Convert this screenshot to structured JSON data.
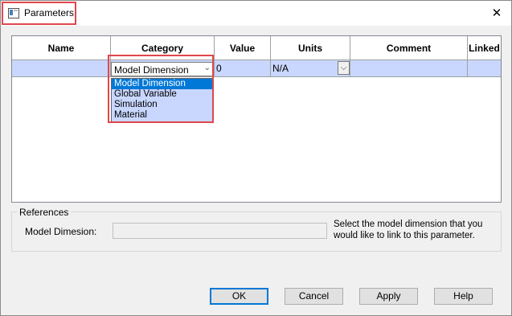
{
  "window": {
    "title": "Parameters",
    "close_glyph": "✕",
    "icon": "window-icon",
    "highlight_color": "#e0474c"
  },
  "grid": {
    "columns": [
      "Name",
      "Category",
      "Value",
      "Units",
      "Comment",
      "Linked"
    ],
    "row": {
      "name": "",
      "category": "Model Dimension",
      "value": "0",
      "units": "N/A",
      "comment": "",
      "linked": ""
    },
    "selected_row_color": "#c9d7ff"
  },
  "category_dropdown": {
    "value": "Model Dimension",
    "options": [
      "Model Dimension",
      "Global Variable",
      "Simulation",
      "Material"
    ],
    "selected_index": 0,
    "selected_color": "#0078d7"
  },
  "references": {
    "title": "References",
    "model_dimension_label": "Model Dimesion:",
    "model_dimension_value": "",
    "hint": "Select the model dimension that you would like to link to this parameter."
  },
  "buttons": {
    "ok": "OK",
    "cancel": "Cancel",
    "apply": "Apply",
    "help": "Help"
  }
}
